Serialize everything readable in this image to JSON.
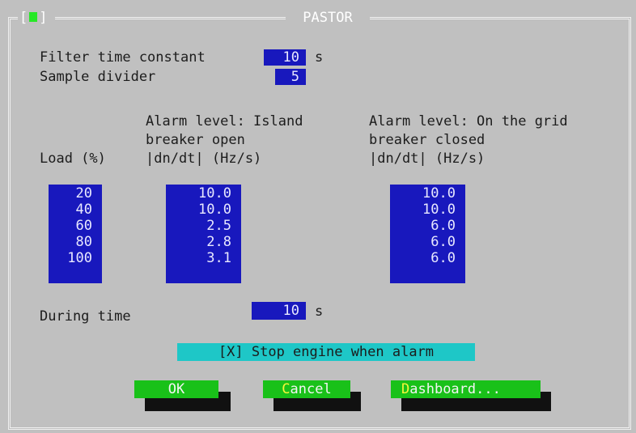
{
  "window": {
    "title": "PASTOR",
    "close_open": "[",
    "close_close": "]"
  },
  "settings": {
    "filter_label": "Filter time constant",
    "filter_value": "10",
    "filter_unit": "s",
    "divider_label": "Sample divider",
    "divider_value": "5"
  },
  "headers": {
    "load": "Load (%)",
    "island_line1": "Alarm level: Island",
    "island_line2": "breaker open",
    "island_line3": "|dn/dt| (Hz/s)",
    "grid_line1": "Alarm level: On the grid",
    "grid_line2": "breaker closed",
    "grid_line3": "|dn/dt| (Hz/s)"
  },
  "table": {
    "load": [
      "20",
      "40",
      "60",
      "80",
      "100"
    ],
    "island": [
      "10.0",
      "10.0",
      "2.5",
      "2.8",
      "3.1"
    ],
    "grid": [
      "10.0",
      "10.0",
      "6.0",
      "6.0",
      "6.0"
    ]
  },
  "during": {
    "label": "During time",
    "value": "10",
    "unit": "s"
  },
  "checkbox": {
    "text": "[X] Stop engine when alarm"
  },
  "buttons": {
    "ok": "OK",
    "cancel_hot": "C",
    "cancel_rest": "ancel",
    "dashboard_hot": "D",
    "dashboard_rest": "ashboard..."
  },
  "colors": {
    "background": "#c0c0c0",
    "field": "#1818bd",
    "button": "#19c119",
    "checkbox": "#1ec7c7",
    "hotkey": "#f6f63a"
  }
}
